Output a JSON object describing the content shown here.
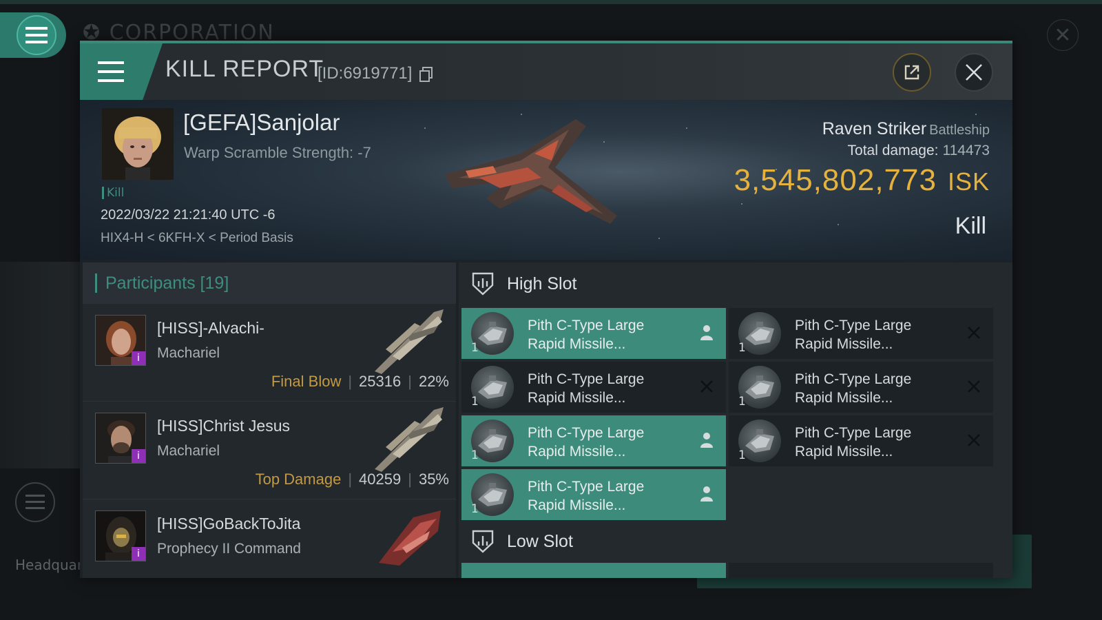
{
  "background": {
    "corp_title": "CORPORATION",
    "hq_label": "Headquar"
  },
  "dialog": {
    "title": "KILL REPORT",
    "id_label": "[ID:6919771]"
  },
  "victim": {
    "name": "[GEFA]Sanjolar",
    "warp_scramble": "Warp Scramble Strength: -7",
    "tag": "Kill",
    "datetime": "2022/03/22 21:21:40 UTC -6",
    "location": "HIX4-H < 6KFH-X < Period Basis",
    "ship": "Raven Striker",
    "ship_class": "Battleship",
    "total_damage_label": "Total damage:",
    "total_damage": "114473",
    "isk_value": "3,545,802,773",
    "isk_unit": "ISK",
    "result": "Kill"
  },
  "participants": {
    "header": "Participants [19]",
    "items": [
      {
        "name": "[HISS]-Alvachi-",
        "ship": "Machariel",
        "role": "Final Blow",
        "damage": "25316",
        "percent": "22%"
      },
      {
        "name": "[HISS]Christ Jesus",
        "ship": "Machariel",
        "role": "Top Damage",
        "damage": "40259",
        "percent": "35%"
      },
      {
        "name": "[HISS]GoBackToJita",
        "ship": "Prophecy II Command",
        "role": "",
        "damage": "",
        "percent": ""
      }
    ]
  },
  "fitting": {
    "high_slot_label": "High Slot",
    "low_slot_label": "Low Slot",
    "high_modules": [
      {
        "qty": "1",
        "line1": "Pith C-Type Large",
        "line2": "Rapid Missile...",
        "state": "dropped"
      },
      {
        "qty": "1",
        "line1": "Pith C-Type Large",
        "line2": "Rapid Missile...",
        "state": "destroyed"
      },
      {
        "qty": "1",
        "line1": "Pith C-Type Large",
        "line2": "Rapid Missile...",
        "state": "destroyed"
      },
      {
        "qty": "1",
        "line1": "Pith C-Type Large",
        "line2": "Rapid Missile...",
        "state": "destroyed"
      },
      {
        "qty": "1",
        "line1": "Pith C-Type Large",
        "line2": "Rapid Missile...",
        "state": "dropped"
      },
      {
        "qty": "1",
        "line1": "Pith C-Type Large",
        "line2": "Rapid Missile...",
        "state": "destroyed"
      },
      {
        "qty": "1",
        "line1": "Pith C-Type Large",
        "line2": "Rapid Missile...",
        "state": "dropped"
      }
    ]
  },
  "colors": {
    "accent": "#3d8c7b",
    "isk": "#e6b23e",
    "role": "#c29a45",
    "badge": "#8e2fb5"
  }
}
